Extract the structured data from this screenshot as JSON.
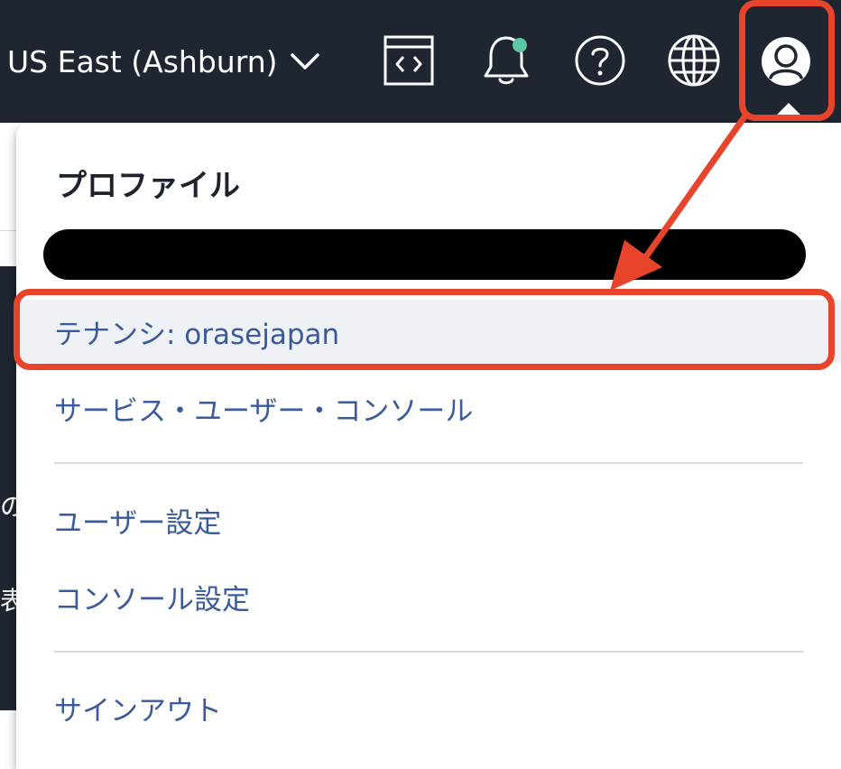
{
  "topbar": {
    "region_label": "US East (Ashburn)",
    "icons": [
      "code-editor-icon",
      "bell-icon",
      "help-icon",
      "globe-icon",
      "profile-icon"
    ],
    "notification_dot_color": "#5fc7a4"
  },
  "background_page": {
    "fragment_1": "の",
    "fragment_2": "表"
  },
  "profile_menu": {
    "title": "プロファイル",
    "tenancy_label": "テナンシ: orasejapan",
    "service_user_console_label": "サービス・ユーザー・コンソール",
    "user_settings_label": "ユーザー設定",
    "console_settings_label": "コンソール設定",
    "sign_out_label": "サインアウト"
  },
  "colors": {
    "nav_background": "#1f2631",
    "link_color": "#3a5a9a",
    "highlight_background": "#eef1f6",
    "annotation_red": "#e8432b"
  }
}
